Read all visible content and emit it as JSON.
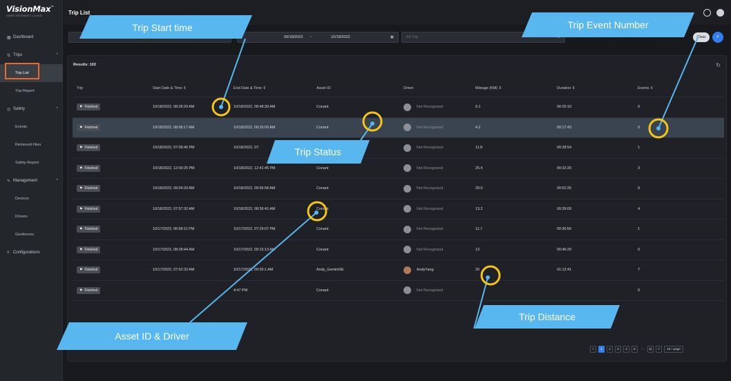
{
  "logo": {
    "name": "VisionMax",
    "tm": "™",
    "subtitle": "VIDEO TELEMATIC CLOUD"
  },
  "sidebar": {
    "items": [
      {
        "icon": "dashboard-icon",
        "label": "Dashboard",
        "type": "top"
      },
      {
        "icon": "trips-icon",
        "label": "Trips",
        "type": "group"
      },
      {
        "label": "Trip List",
        "type": "sub",
        "active": true
      },
      {
        "label": "Trip Report",
        "type": "sub"
      },
      {
        "icon": "safety-icon",
        "label": "Safety",
        "type": "group"
      },
      {
        "label": "Events",
        "type": "sub"
      },
      {
        "label": "Retrieved Files",
        "type": "sub"
      },
      {
        "label": "Safety Report",
        "type": "sub"
      },
      {
        "icon": "management-icon",
        "label": "Management",
        "type": "group"
      },
      {
        "label": "Devices",
        "type": "sub"
      },
      {
        "label": "Drivers",
        "type": "sub"
      },
      {
        "label": "Geofences",
        "type": "sub"
      },
      {
        "icon": "configurations-icon",
        "label": "Configurations",
        "type": "top"
      }
    ]
  },
  "header": {
    "title": "Trip List"
  },
  "filters": {
    "date_from": "09/18/2022",
    "date_sep": "~",
    "date_to": "10/18/2022",
    "trip_placeholder": "All Trip",
    "clear_label": "Clear"
  },
  "results_label": "Results: 102",
  "table": {
    "columns": [
      "Trip",
      "Start Date & Time ⇕",
      "End Date & Time ⇕",
      "Asset ID",
      "Driver",
      "Mileage (KM) ⇕",
      "Duration ⇕",
      "Events ⇕"
    ],
    "rows": [
      {
        "status": "Finished",
        "start": "10/18/2022, 08:28:29 AM",
        "end": "10/18/2022, 08:48:39 AM",
        "asset": "Conant",
        "driver": "Not Recognized",
        "mileage": "9.1",
        "duration": "00:20:10",
        "events": "0"
      },
      {
        "status": "Finished",
        "start": "10/18/2022, 08:08:17 AM",
        "end": "10/18/2022, 08:26:00 AM",
        "asset": "Conant",
        "driver": "Not Recognized",
        "mileage": "4.2",
        "duration": "00:17:43",
        "events": "0",
        "selected": true
      },
      {
        "status": "Finished",
        "start": "10/18/2022, 07:08:40 PM",
        "end": "10/18/2022, 07:",
        "asset": "",
        "driver": "Not Recognized",
        "mileage": "11.8",
        "duration": "00:28:54",
        "events": "1"
      },
      {
        "status": "Finished",
        "start": "10/18/2022, 12:09:25 PM",
        "end": "10/18/2022, 12:41:45 PM",
        "asset": "Conant",
        "driver": "Not Recognized",
        "mileage": "25.4",
        "duration": "00:32:20",
        "events": "3"
      },
      {
        "status": "Finished",
        "start": "10/18/2022, 09:04:33 AM",
        "end": "10/18/2022, 09:56:58 AM",
        "asset": "Conant",
        "driver": "Not Recognized",
        "mileage": "29.0",
        "duration": "00:52:25",
        "events": "9"
      },
      {
        "status": "Finished",
        "start": "10/18/2022, 07:57:32 AM",
        "end": "10/18/2022, 08:36:41 AM",
        "asset": "Conant",
        "driver": "Not Recognized",
        "mileage": "13.2",
        "duration": "00:39:09",
        "events": "4"
      },
      {
        "status": "Finished",
        "start": "10/17/2022, 06:58:11 PM",
        "end": "10/17/2022, 07:29:07 PM",
        "asset": "Conant",
        "driver": "Not Recognized",
        "mileage": "11.7",
        "duration": "00:30:56",
        "events": "1"
      },
      {
        "status": "Finished",
        "start": "10/17/2022, 08:28:44 AM",
        "end": "10/17/2022, 09:15:13 AM",
        "asset": "Conant",
        "driver": "Not Recognized",
        "mileage": "13",
        "duration": "00:46:29",
        "events": "0"
      },
      {
        "status": "Finished",
        "start": "10/17/2022, 07:52:33 AM",
        "end": "10/17/2022, 09:05:1 AM",
        "asset": "Andy_GeminiSE",
        "driver": "AndyYang",
        "mileage": "20",
        "duration": "01:12:41",
        "events": "7",
        "driver_photo": true
      },
      {
        "status": "Finished",
        "start": "",
        "end": "4:47 PM",
        "asset": "Conant",
        "driver": "Not Recognized",
        "mileage": "",
        "duration": "",
        "events": "0"
      }
    ]
  },
  "pagination": {
    "pages": [
      "1",
      "2",
      "3",
      "4",
      "5"
    ],
    "ellipsis": "···",
    "last": "11",
    "page_size": "10 / page"
  },
  "callouts": {
    "trip_start": "Trip Start time",
    "trip_event_number": "Trip Event Number",
    "trip_status": "Trip Status",
    "trip_distance": "Trip Distance",
    "asset_driver": "Asset ID & Driver"
  },
  "colors": {
    "callout": "#57b7ee",
    "marker": "#f5c518",
    "accent": "#2f7ff0",
    "highlight": "#e96a2a"
  }
}
